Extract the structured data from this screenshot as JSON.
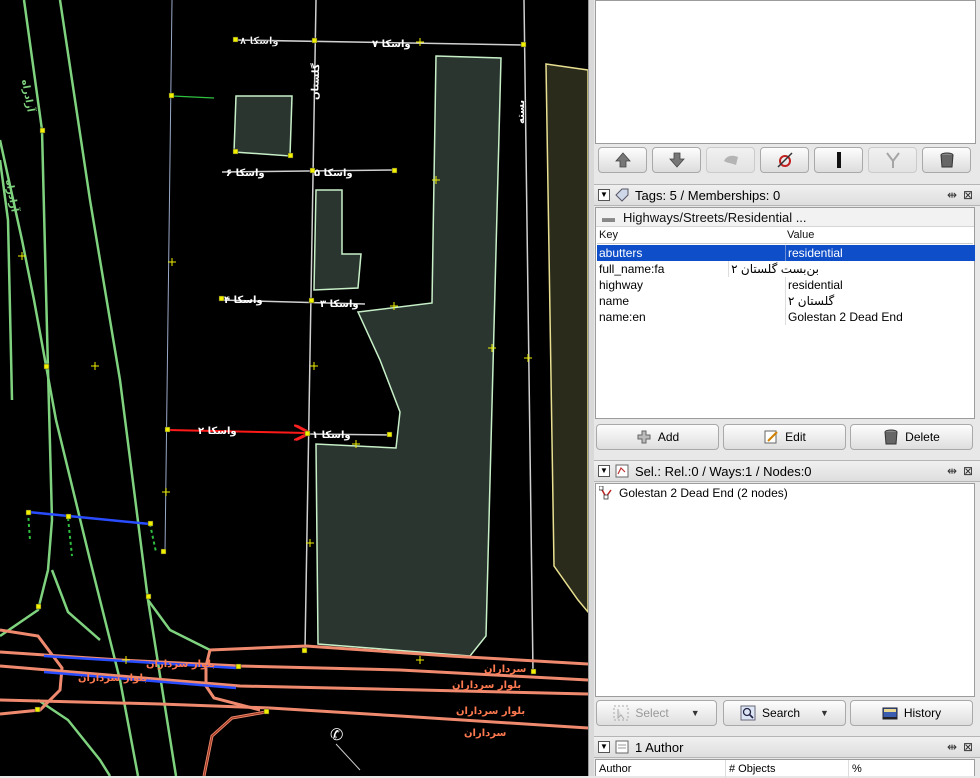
{
  "map": {
    "labels": [
      {
        "id": "l1",
        "text": "۸ واسکا",
        "color": "#ffffff"
      },
      {
        "id": "l2",
        "text": "۷ واسکا",
        "color": "#ffffff"
      },
      {
        "id": "l3",
        "text": "گلستان",
        "color": "#ffffff"
      },
      {
        "id": "l4",
        "text": "بسته",
        "color": "#ffffff"
      },
      {
        "id": "l5",
        "text": "۵ واسکا",
        "color": "#ffffff"
      },
      {
        "id": "l6",
        "text": "۶ واسکا",
        "color": "#ffffff"
      },
      {
        "id": "l7",
        "text": "۴ واسکا",
        "color": "#ffffff"
      },
      {
        "id": "l8",
        "text": "۳ واسکا",
        "color": "#ffffff"
      },
      {
        "id": "l9",
        "text": "۲ واسکا",
        "color": "#ffffff"
      },
      {
        "id": "l10",
        "text": "۱ واسکا",
        "color": "#ffffff"
      },
      {
        "id": "l11",
        "text": "بلوار سرداران",
        "color": "#ff7a50"
      },
      {
        "id": "l12",
        "text": "بلوار سرداران",
        "color": "#ff7a50"
      },
      {
        "id": "l13",
        "text": "سرداران",
        "color": "#ff7a50"
      },
      {
        "id": "l14",
        "text": "بلوار سرداران",
        "color": "#ff7a50"
      },
      {
        "id": "l15",
        "text": "بلوار سرداران",
        "color": "#ff7a50"
      },
      {
        "id": "l16",
        "text": "سرداران",
        "color": "#ff7a50"
      },
      {
        "id": "l17",
        "text": "آزادراه",
        "color": "#7fd37f"
      },
      {
        "id": "l18",
        "text": "آزادراه",
        "color": "#7fd37f"
      }
    ],
    "colors": {
      "background": "#000000",
      "residential_way": "#c8c8c8",
      "motorway": "#7fd37f",
      "primary": "#f0806a",
      "selected_way": "#ff0000",
      "building_fill": "#2a3530",
      "building_outline": "#c8f0c8",
      "node": "#e8e800",
      "blue_way": "#2a4cff"
    }
  },
  "toolbar": {
    "buttons": [
      {
        "name": "move-up-icon",
        "enabled": true
      },
      {
        "name": "move-down-icon",
        "enabled": true
      },
      {
        "name": "merge-icon",
        "enabled": false
      },
      {
        "name": "zoom-to-member-icon",
        "enabled": true
      },
      {
        "name": "download-incomplete-icon",
        "enabled": true
      },
      {
        "name": "split-icon",
        "enabled": false
      },
      {
        "name": "delete-member-icon",
        "enabled": true
      }
    ]
  },
  "tags_panel": {
    "title": "Tags: 5 / Memberships: 0",
    "preset": "Highways/Streets/Residential ...",
    "col_key": "Key",
    "col_value": "Value",
    "rows": [
      {
        "key": "abutters",
        "value": "residential",
        "selected": true
      },
      {
        "key": "full_name:fa",
        "value": "بن‌بست گلستان ۲",
        "selected": false
      },
      {
        "key": "highway",
        "value": "residential",
        "selected": false
      },
      {
        "key": "name",
        "value": "گلستان ۲",
        "selected": false
      },
      {
        "key": "name:en",
        "value": "Golestan 2 Dead End",
        "selected": false
      }
    ],
    "add_label": "Add",
    "edit_label": "Edit",
    "delete_label": "Delete"
  },
  "selection_panel": {
    "title": "Sel.: Rel.:0 / Ways:1 / Nodes:0",
    "items": [
      {
        "label": "Golestan 2 Dead End (2 nodes)",
        "icon": "way-icon"
      }
    ],
    "select_label": "Select",
    "search_label": "Search",
    "history_label": "History"
  },
  "authors_panel": {
    "title": "1 Author",
    "col_author": "Author",
    "col_objects": "# Objects",
    "col_percent": "%"
  }
}
